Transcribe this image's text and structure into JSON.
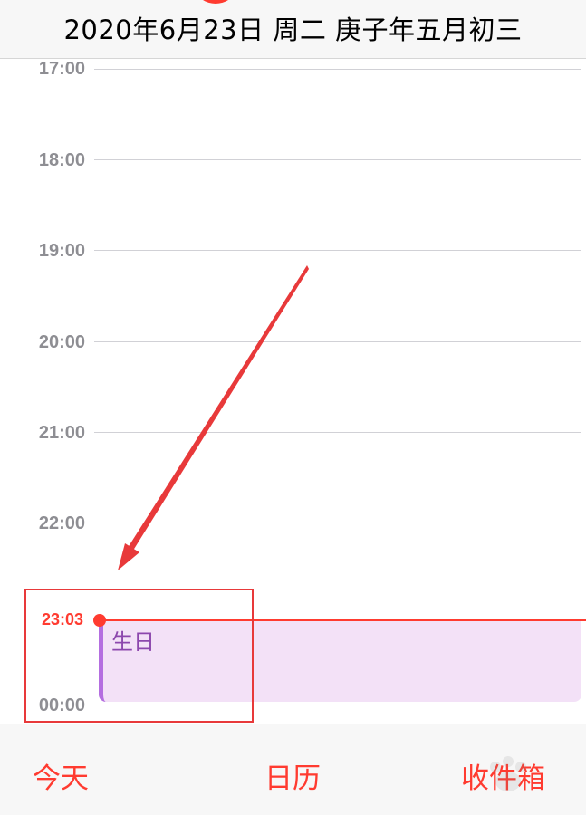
{
  "header": {
    "title": "2020年6月23日 周二  庚子年五月初三"
  },
  "timeline": {
    "hours": [
      "17:00",
      "18:00",
      "19:00",
      "20:00",
      "21:00",
      "22:00",
      "00:00"
    ],
    "current_time": "23:03"
  },
  "event": {
    "title": "生日",
    "color": "#b46ee0"
  },
  "tabbar": {
    "today": "今天",
    "calendar": "日历",
    "inbox": "收件箱"
  },
  "colors": {
    "accent": "#ff3b30",
    "event_bg": "#f3e1f7",
    "annotation": "#e8393a"
  }
}
